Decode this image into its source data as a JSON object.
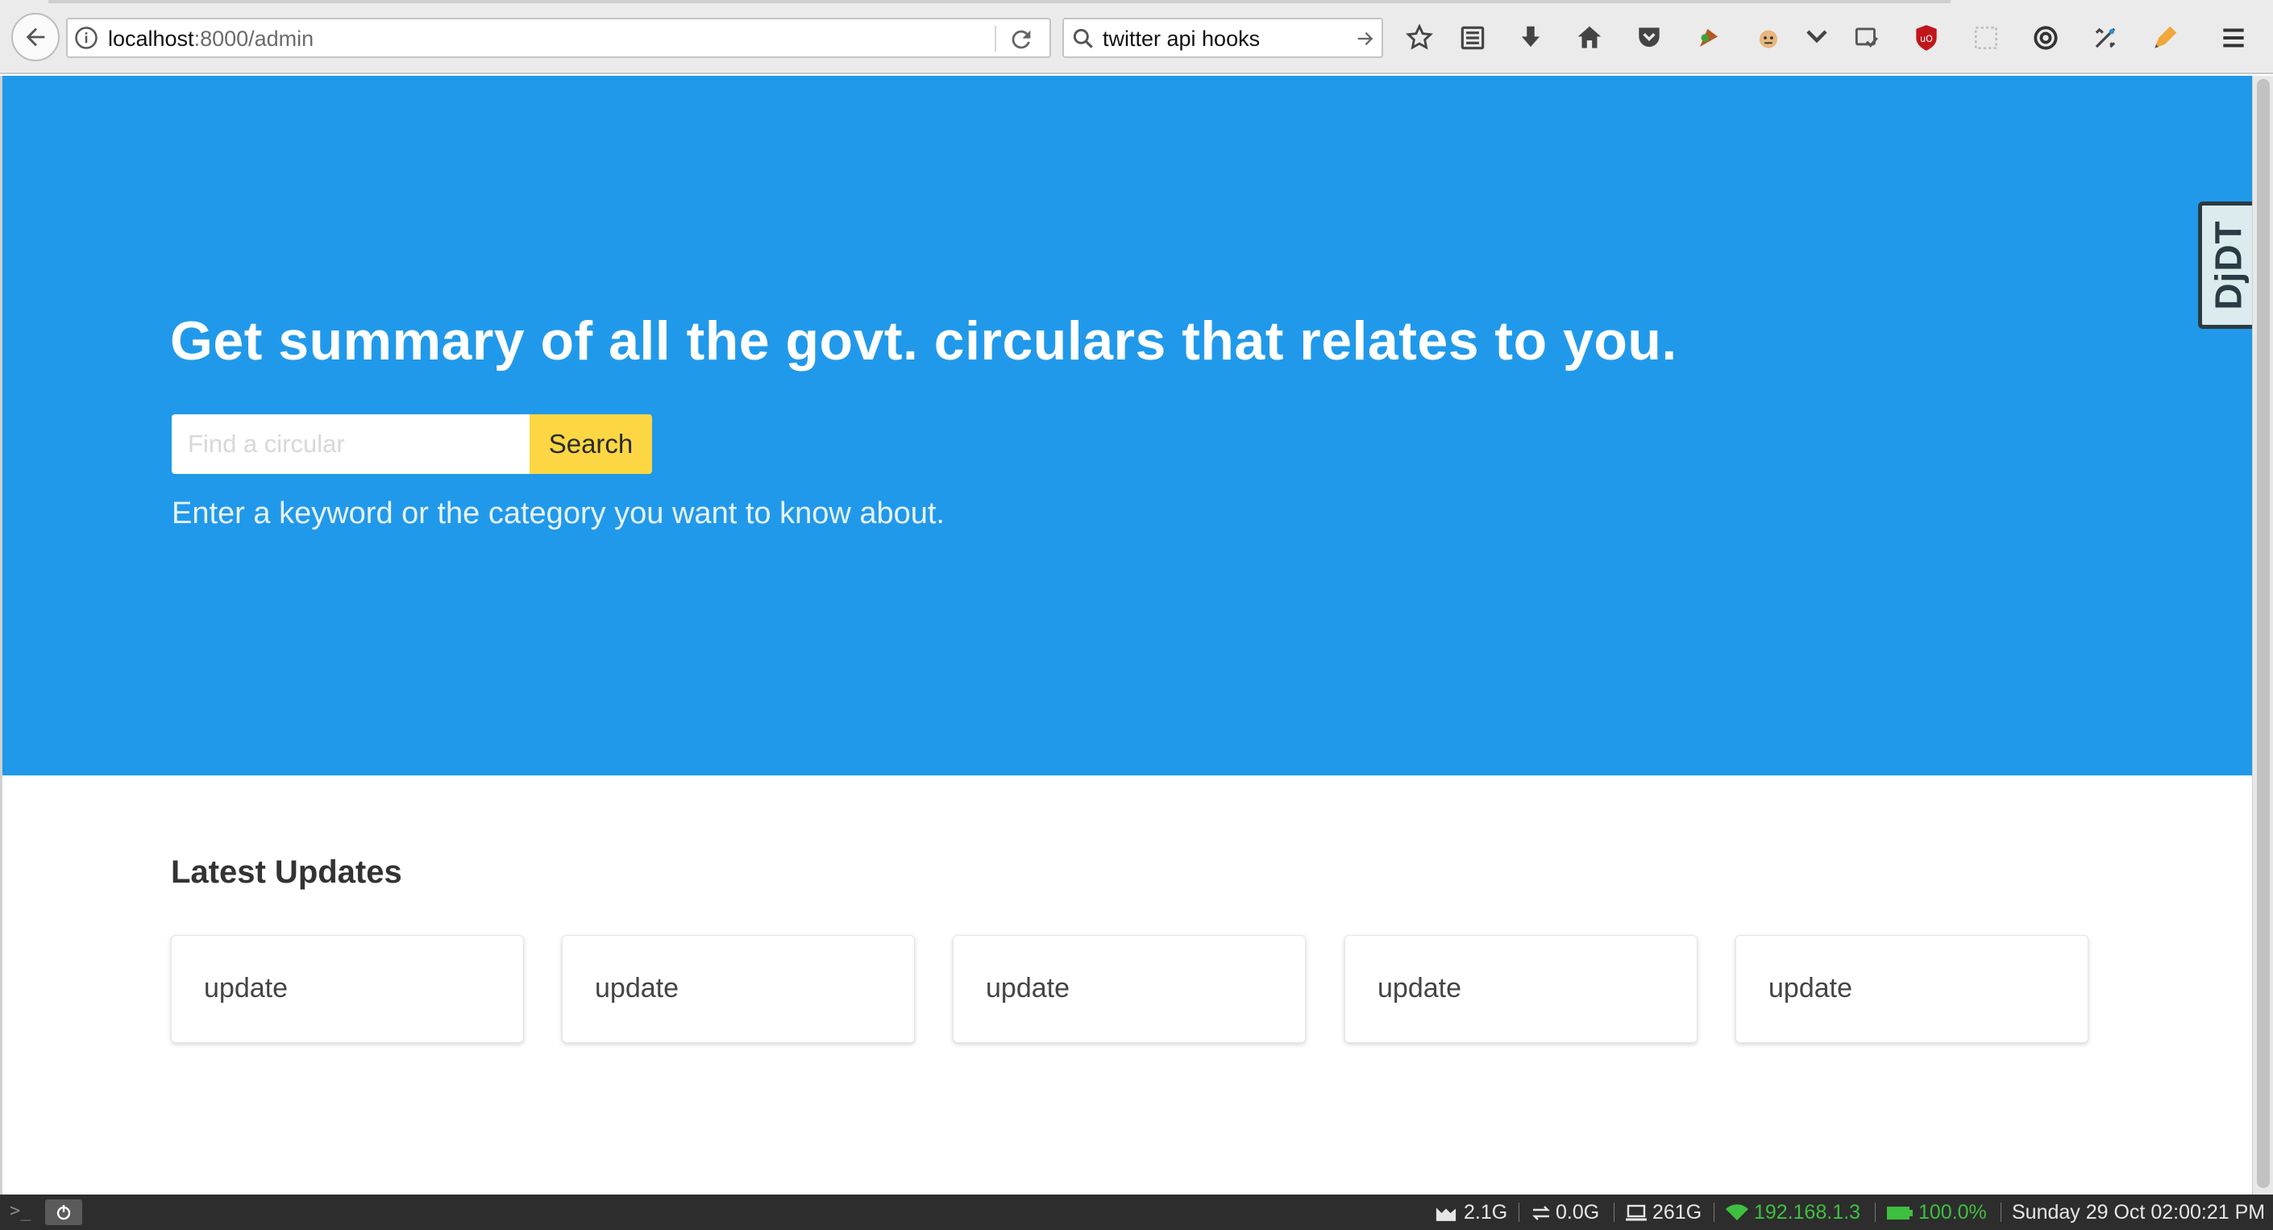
{
  "browser": {
    "url_host": "localhost",
    "url_path": ":8000/admin",
    "search_query": "twitter api hooks",
    "toolbar_icons": [
      "bookmark-star-icon",
      "reading-list-icon",
      "download-icon",
      "home-icon",
      "pocket-icon",
      "extension-icon",
      "greasemonkey-icon",
      "chevron-down-icon",
      "sync-icon",
      "ublock-icon",
      "screenshot-icon",
      "proxy-icon",
      "tools-icon",
      "pen-icon",
      "hamburger-menu-icon"
    ]
  },
  "hero": {
    "title": "Get summary of all the govt. circulars that relates to you.",
    "search_placeholder": "Find a circular",
    "search_button": "Search",
    "hint": "Enter a keyword or the category you want to know about.",
    "background_color": "#2199ea",
    "button_color": "#fcd743"
  },
  "updates": {
    "heading": "Latest Updates",
    "cards": [
      {
        "label": "update"
      },
      {
        "label": "update"
      },
      {
        "label": "update"
      },
      {
        "label": "update"
      },
      {
        "label": "update"
      }
    ]
  },
  "debug_toolbar": {
    "label": "DjDT"
  },
  "taskbar": {
    "terminal": ">_",
    "mem": "2.1G",
    "swap": "0.0G",
    "disk": "261G",
    "ip": "192.168.1.3",
    "battery": "100.0%",
    "datetime": "Sunday 29 Oct 02:00:21 PM"
  }
}
